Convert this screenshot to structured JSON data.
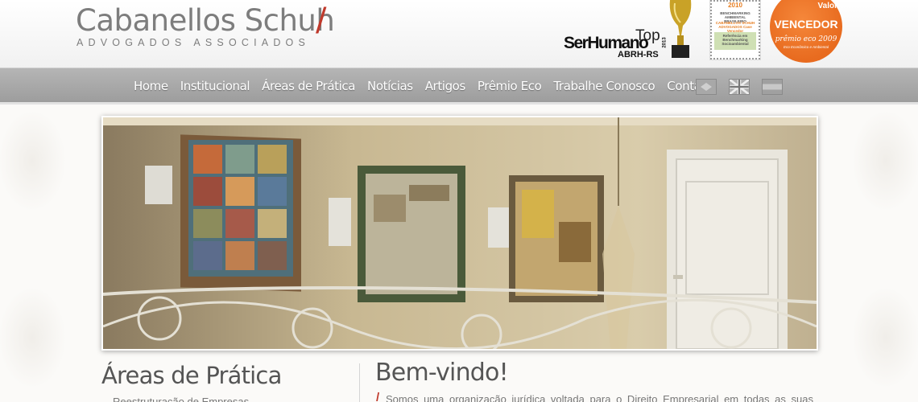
{
  "header": {
    "logo_title": "Cabanellos Schuh",
    "logo_slash": "/",
    "logo_subtitle": "ADVOGADOS ASSOCIADOS",
    "award_top": {
      "top": "Top",
      "ser_humano": "SerHumano",
      "abrh": "ABRH-RS",
      "year": "2013"
    },
    "stamp": {
      "year": "2010",
      "line1": "BENCHMARKING AMBIENTAL BRASILEIRO",
      "line2": "CABANELLOS SCHUH ADVOGADOS Case Vencedor",
      "line3": "Referência em Benchmarking Socioambiental"
    },
    "badge": {
      "valor": "Valor",
      "vencedor": "VENCEDOR",
      "premio": "prêmio eco 2009",
      "small": "Eco Econômico e Ambiental"
    }
  },
  "nav": {
    "items": [
      {
        "label": "Home"
      },
      {
        "label": "Institucional"
      },
      {
        "label": "Áreas de Prática"
      },
      {
        "label": "Notícias"
      },
      {
        "label": "Artigos"
      },
      {
        "label": "Prêmio Eco"
      },
      {
        "label": "Trabalhe Conosco"
      },
      {
        "label": "Contato"
      }
    ],
    "flags": [
      "brazil-flag-icon",
      "uk-flag-icon",
      "spain-flag-icon"
    ]
  },
  "hero": {
    "description_icon": "office-gallery-photo"
  },
  "sidebar": {
    "title": "Áreas de Prática",
    "first_link": "Reestruturação de Empresas"
  },
  "main": {
    "title": "Bem-vindo!",
    "intro": "Somos uma organização jurídica voltada para o Direito Empresarial em todas as suas"
  },
  "colors": {
    "accent": "#c0392b",
    "nav_bg": "#a8a8a8",
    "badge": "#e86b1f"
  }
}
